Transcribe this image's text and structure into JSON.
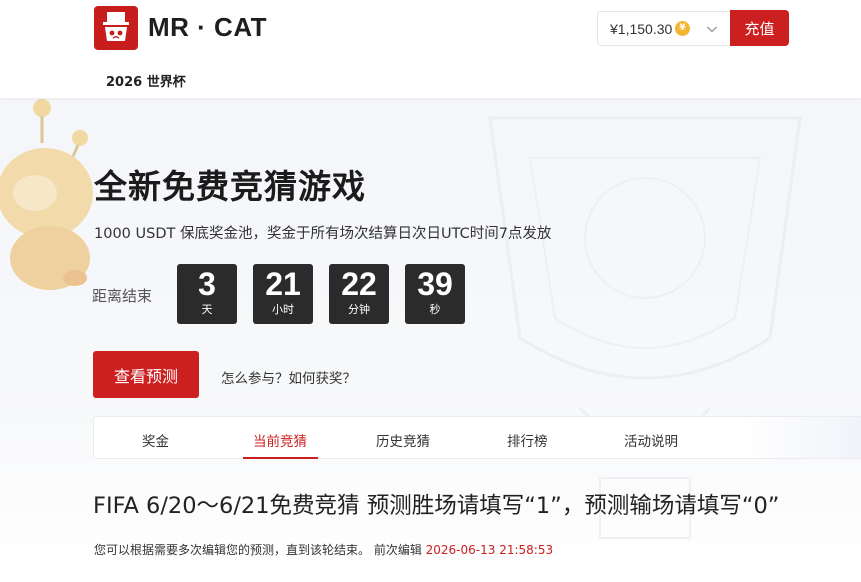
{
  "header": {
    "brand": "MR · CAT",
    "nav_item": "2026 世界杯",
    "balance": "¥1,150.30",
    "coin_symbol": "¥",
    "topup_label": "充值"
  },
  "hero": {
    "title": "全新免费竞猜游戏",
    "subtitle": "1000 USDT 保底奖金池，奖金于所有场次结算日次日UTC时间7点发放",
    "countdown_label": "距离结束",
    "countdown": [
      {
        "value": "3",
        "unit": "天"
      },
      {
        "value": "21",
        "unit": "小时"
      },
      {
        "value": "22",
        "unit": "分钟"
      },
      {
        "value": "39",
        "unit": "秒"
      }
    ],
    "view_button": "查看预测",
    "help_link": "怎么参与？如何获奖？"
  },
  "tabs": [
    {
      "label": "奖金",
      "active": false
    },
    {
      "label": "当前竞猜",
      "active": true
    },
    {
      "label": "历史竞猜",
      "active": false
    },
    {
      "label": "排行榜",
      "active": false
    },
    {
      "label": "活动说明",
      "active": false
    }
  ],
  "section": {
    "title": "FIFA 6/20～6/21免费竞猜 预测胜场请填写“1”，预测输场请填写“0”",
    "note": "您可以根据需要多次编辑您的预测，直到该轮结束。 前次编辑 ",
    "last_edit": "2026-06-13 21:58:53"
  },
  "colors": {
    "accent": "#cc1f1f",
    "countdown_bg": "#2b2b2b",
    "coin": "#f2b632"
  }
}
